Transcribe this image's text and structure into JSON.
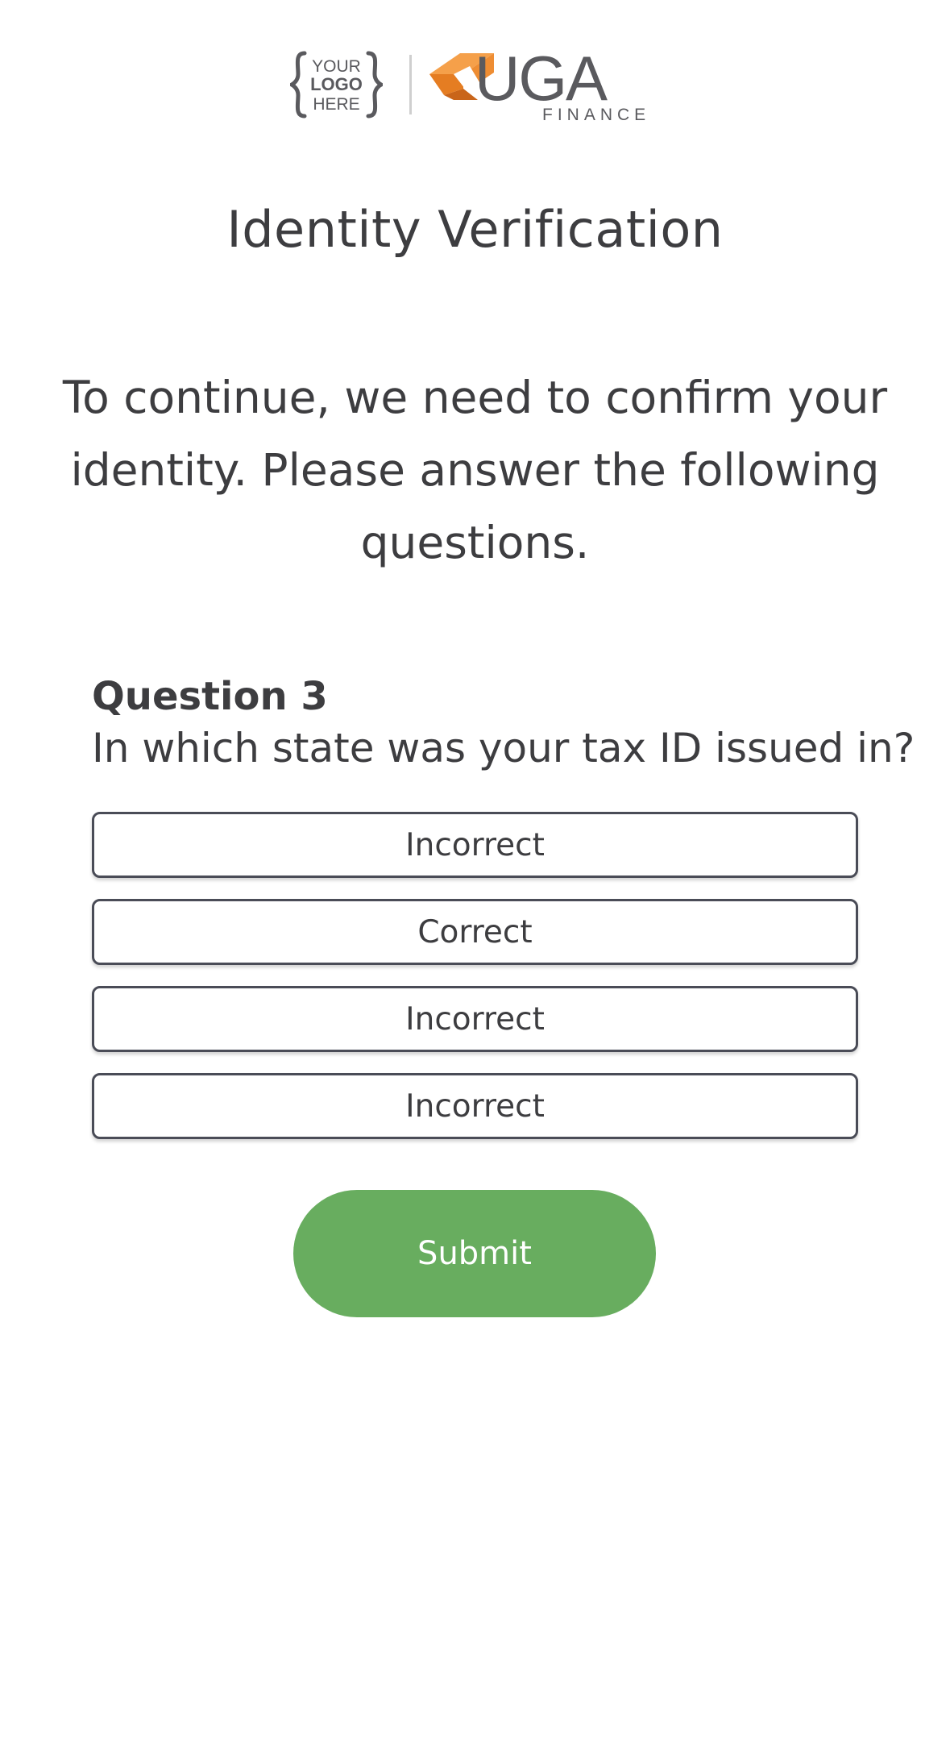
{
  "header": {
    "partner_logo": {
      "line1": "YOUR",
      "line2": "LOGO",
      "line3": "HERE"
    },
    "brand": {
      "name": "UGA",
      "subtitle": "FINANCE",
      "accent_color": "#ec8a2f"
    }
  },
  "page": {
    "title": "Identity Verification",
    "intro": "To continue, we need to confirm your identity. Please answer the following questions."
  },
  "question": {
    "number_label": "Question 3",
    "text": "In which state was your tax ID issued in?",
    "options": [
      {
        "label": "Incorrect"
      },
      {
        "label": "Correct"
      },
      {
        "label": "Incorrect"
      },
      {
        "label": "Incorrect"
      }
    ]
  },
  "actions": {
    "submit_label": "Submit",
    "submit_color": "#68ad5f"
  }
}
